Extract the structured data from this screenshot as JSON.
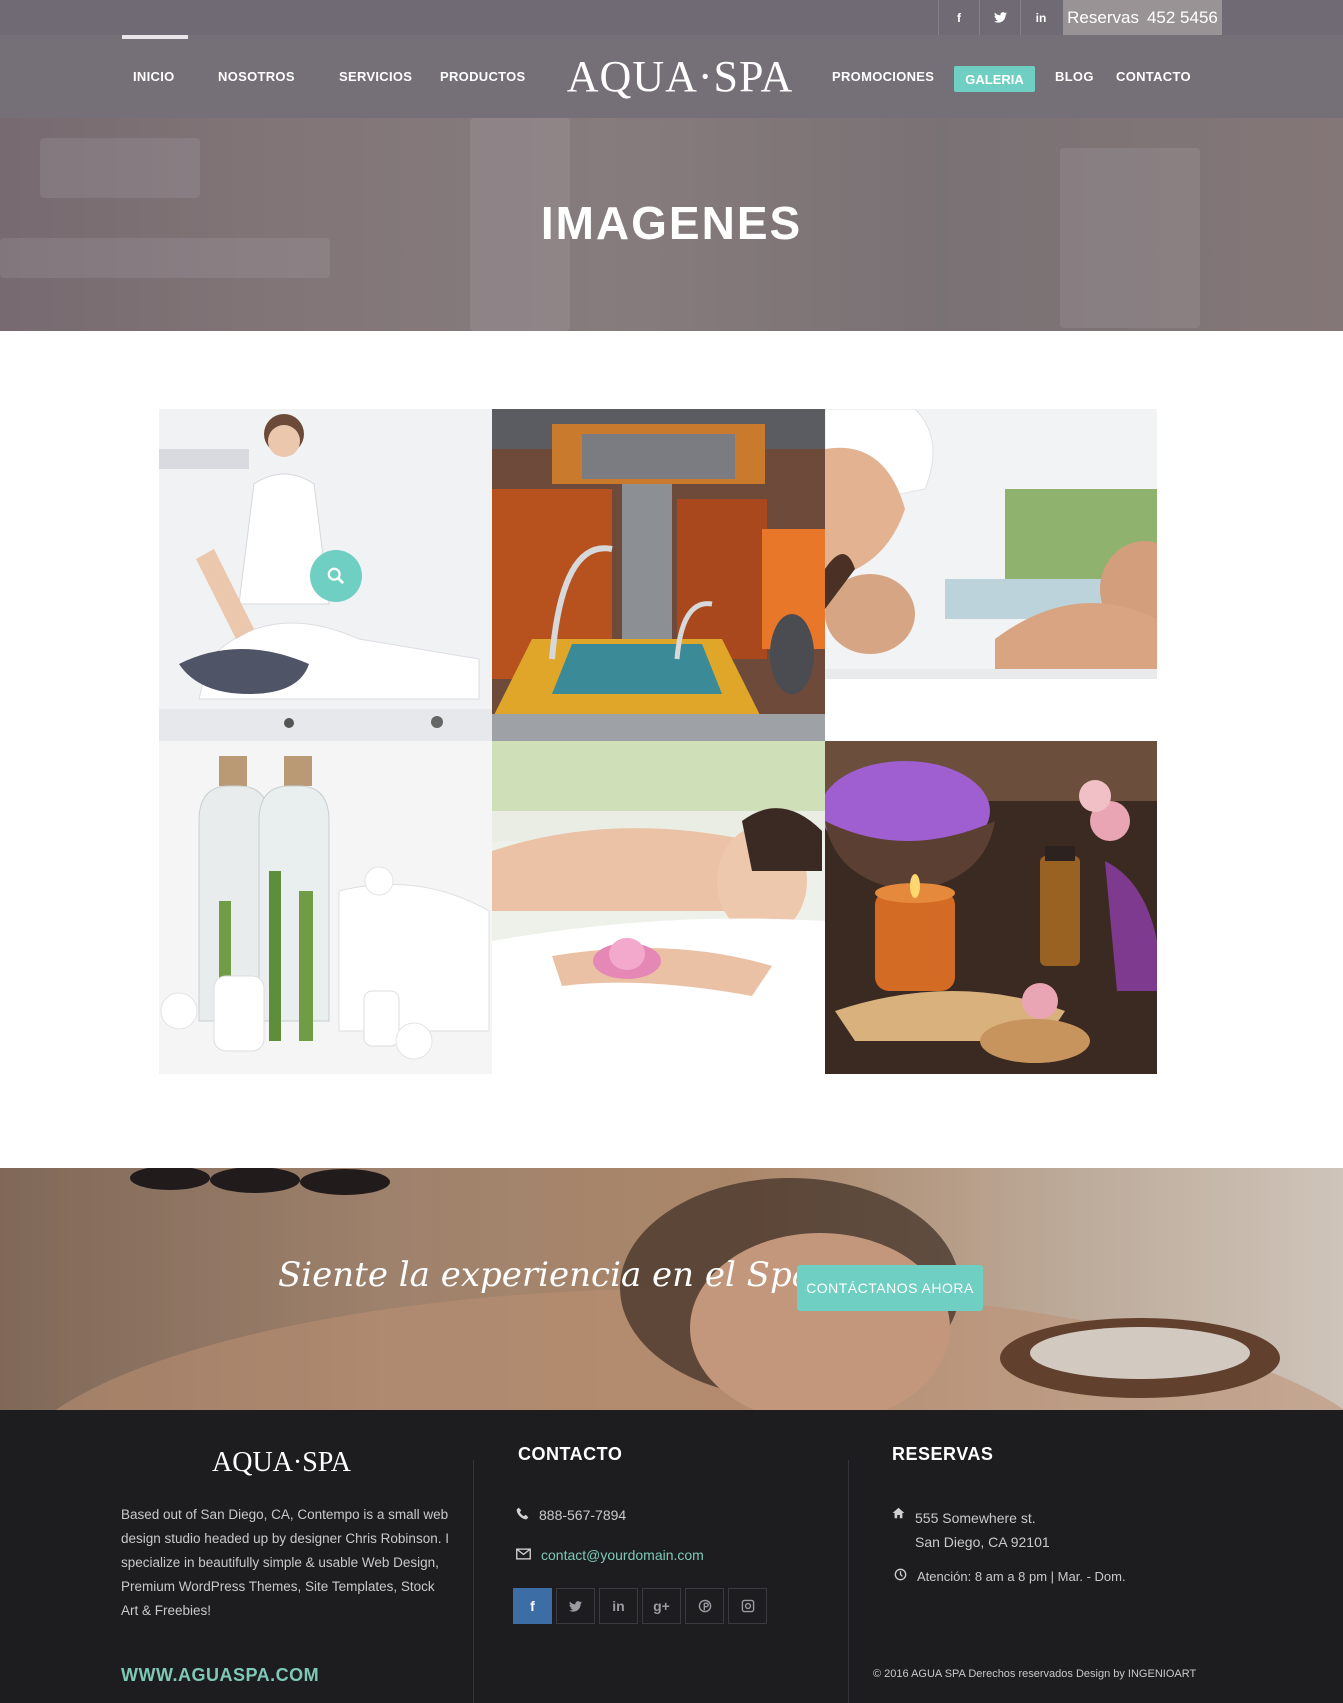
{
  "topbar": {
    "social": [
      {
        "icon": "facebook-icon",
        "glyph": "f"
      },
      {
        "icon": "twitter-icon",
        "glyph": "t"
      },
      {
        "icon": "linkedin-icon",
        "glyph": "in"
      }
    ],
    "reserve_label": "Reservas",
    "reserve_phone": "452 5456"
  },
  "nav": {
    "logo": "AQUA·SPA",
    "items": [
      "INICIO",
      "NOSOTROS",
      "SERVICIOS",
      "PRODUCTOS",
      "PROMOCIONES",
      "GALERIA",
      "BLOG",
      "CONTACTO"
    ],
    "active": "INICIO",
    "highlight": "GALERIA"
  },
  "hero": {
    "title": "IMAGENES"
  },
  "cta": {
    "script_text": "Siente la experiencia en el Spa",
    "button": "CONTÁCTANOS  AHORA"
  },
  "footer": {
    "logo": "AQUA·SPA",
    "about": "Based out of San Diego, CA, Contempo is a small web design studio headed up by designer Chris Robinson. I specialize in beautifully simple & usable Web Design, Premium WordPress Themes, Site Templates, Stock Art & Freebies!",
    "website": "WWW.AGUASPA.COM",
    "contact_heading": "CONTACTO",
    "phone": "888-567-7894",
    "email": "contact@yourdomain.com",
    "social": [
      "f",
      "t",
      "in",
      "g+",
      "p",
      "ig"
    ],
    "reservas_heading": "RESERVAS",
    "address_1": "555 Somewhere st.",
    "address_2": "San Diego, CA 92101",
    "hours": "Atención: 8 am a 8 pm  |  Mar. - Dom.",
    "copyright": "© 2016   AGUA SPA   Derechos reservados Design by INGENIOART"
  },
  "colors": {
    "accent": "#6fcfc2",
    "nav_bg": "#756f78",
    "footer_bg": "#1d1d20"
  }
}
